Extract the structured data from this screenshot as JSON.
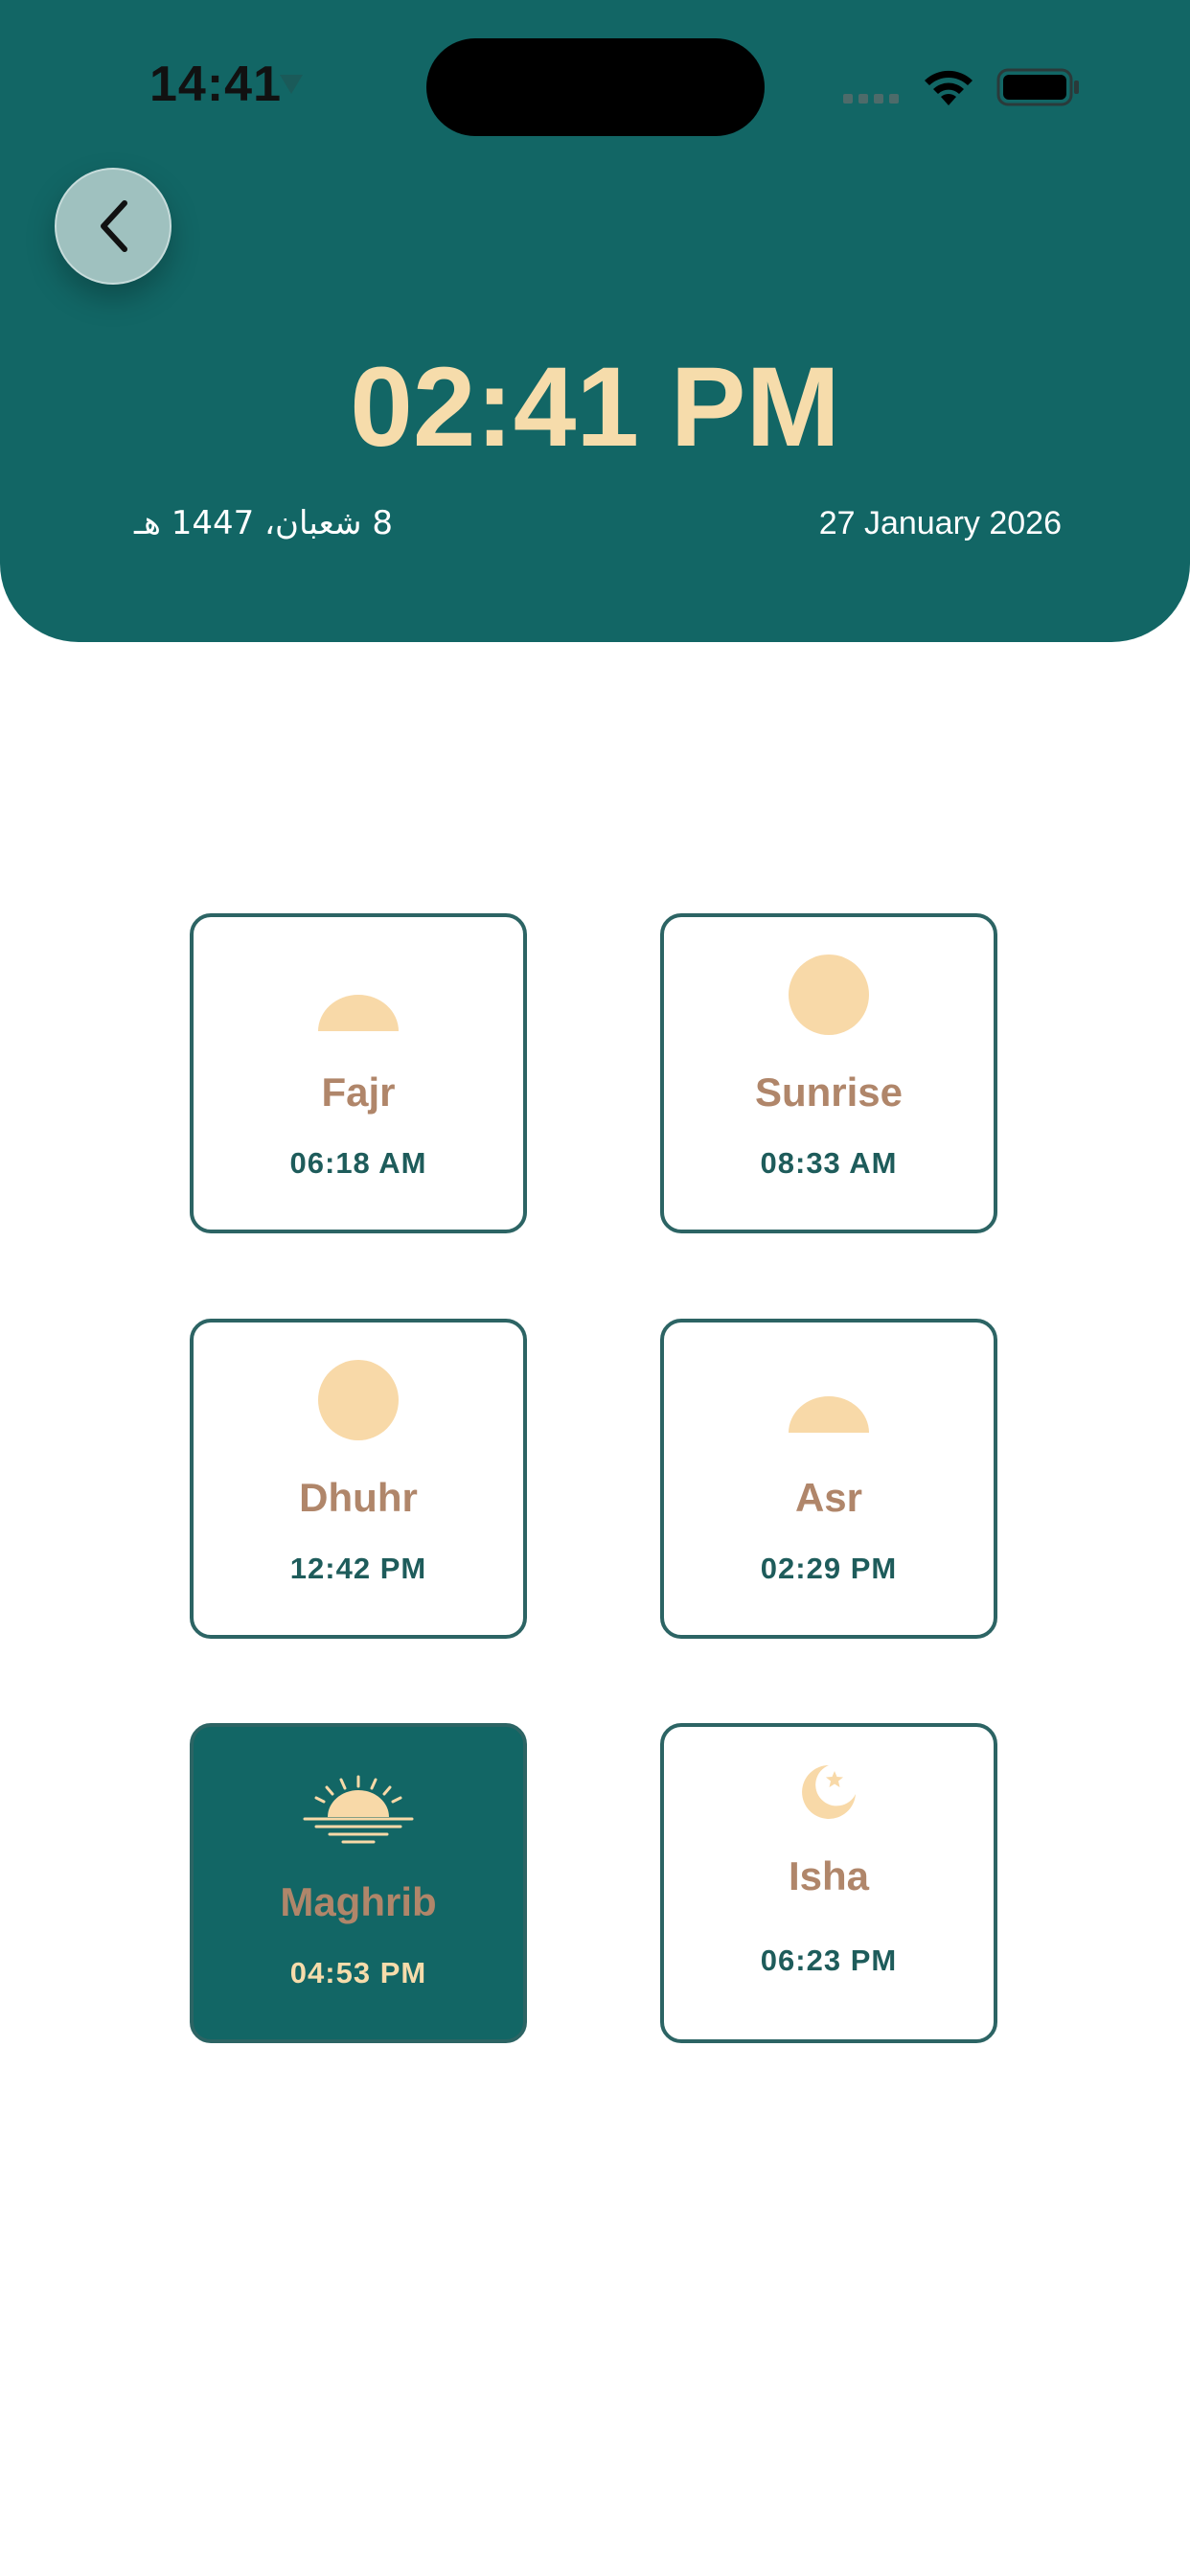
{
  "status_bar": {
    "time": "14:41"
  },
  "header": {
    "current_time": "02:41 PM",
    "hijri_date": "8 شعبان، 1447 هـ",
    "gregorian_date": "27 January 2026"
  },
  "colors": {
    "primary": "#126665",
    "accent": "#f6dcab",
    "prayer_name": "#b0866a",
    "card_border": "#2c6464"
  },
  "prayers": [
    {
      "name": "Fajr",
      "time": "06:18 AM",
      "icon": "half-sun-icon",
      "active": false
    },
    {
      "name": "Sunrise",
      "time": "08:33 AM",
      "icon": "full-sun-icon",
      "active": false
    },
    {
      "name": "Dhuhr",
      "time": "12:42 PM",
      "icon": "full-sun-icon",
      "active": false
    },
    {
      "name": "Asr",
      "time": "02:29 PM",
      "icon": "half-sun-icon",
      "active": false
    },
    {
      "name": "Maghrib",
      "time": "04:53 PM",
      "icon": "sunset-icon",
      "active": true
    },
    {
      "name": "Isha",
      "time": "06:23 PM",
      "icon": "crescent-star-icon",
      "active": false
    }
  ]
}
